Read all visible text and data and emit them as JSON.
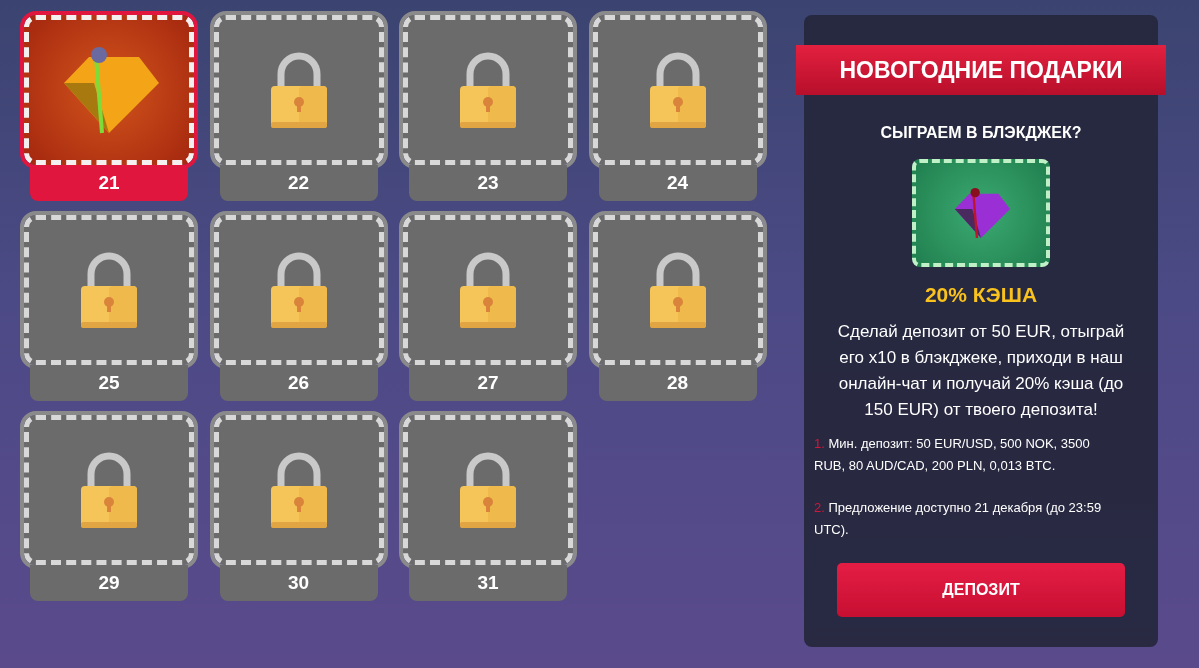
{
  "days": [
    {
      "label": "21",
      "selected": true,
      "locked": false
    },
    {
      "label": "22",
      "selected": false,
      "locked": true
    },
    {
      "label": "23",
      "selected": false,
      "locked": true
    },
    {
      "label": "24",
      "selected": false,
      "locked": true
    },
    {
      "label": "25",
      "selected": false,
      "locked": true
    },
    {
      "label": "26",
      "selected": false,
      "locked": true
    },
    {
      "label": "27",
      "selected": false,
      "locked": true
    },
    {
      "label": "28",
      "selected": false,
      "locked": true
    },
    {
      "label": "29",
      "selected": false,
      "locked": true
    },
    {
      "label": "30",
      "selected": false,
      "locked": true
    },
    {
      "label": "31",
      "selected": false,
      "locked": true
    }
  ],
  "panel": {
    "banner": "НОВОГОДНИЕ ПОДАРКИ",
    "subtitle": "СЫГРАЕМ В БЛЭКДЖЕК?",
    "prize": "20% КЭША",
    "description": "Сделай депозит от 50 EUR, отыграй его x10 в блэкджеке, приходи в наш онлайн-чат и получай 20% кэша (до 150 EUR) от твоего депозита!",
    "terms": [
      {
        "number": "1.",
        "text": "Мин. депозит: 50 EUR/USD, 500 NOK, 3500 RUB, 80 AUD/CAD, 200 PLN, 0,013 BTC."
      },
      {
        "number": "2.",
        "text": "Предложение доступно 21 декабря (до 23:59 UTC)."
      }
    ],
    "button": "ДЕПОЗИТ"
  }
}
